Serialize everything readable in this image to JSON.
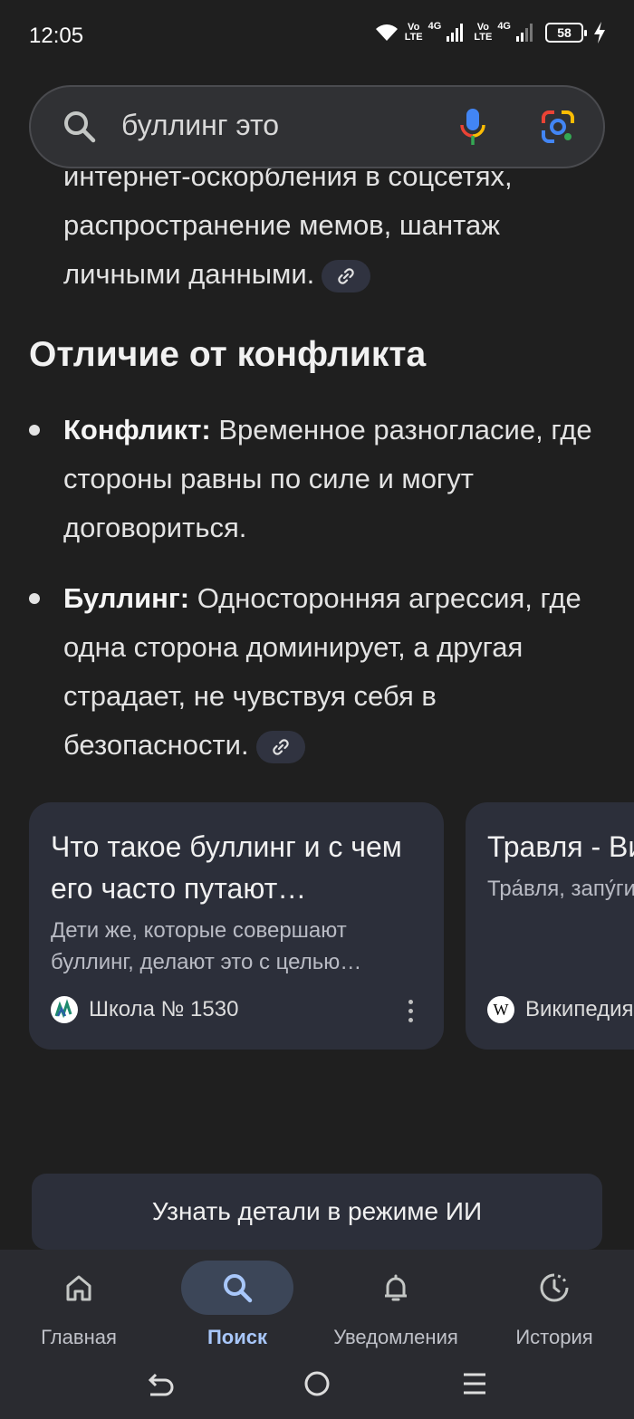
{
  "status_bar": {
    "time": "12:05",
    "sim1_label_top": "Vo",
    "sim1_label_bottom": "LTE",
    "sim1_net": "4G",
    "sim2_label_top": "Vo",
    "sim2_label_bottom": "LTE",
    "sim2_net": "4G",
    "battery": "58"
  },
  "search": {
    "query": "буллинг это"
  },
  "content": {
    "partial_line": "интернет-оскорбления в соцсетях,",
    "para_line1": "распространение мемов, шантаж",
    "para_line2": "личными данными.",
    "section_title": "Отличие от конфликта",
    "bullets": [
      {
        "term": "Конфликт:",
        "text": " Временное разногласие, где стороны равны по силе и могут договориться."
      },
      {
        "term": "Буллинг:",
        "text": " Односторонняя агрессия, где одна сторона доминирует, а другая страдает, не чувствуя себя в безопасности."
      }
    ]
  },
  "cards": [
    {
      "title": "Что такое буллинг и с чем его часто путают…",
      "snippet": "Дети же, которые совершают буллинг, делают это с целью…",
      "source": "Школа № 1530"
    },
    {
      "title": "Травля - Википедия",
      "snippet": "Тра́вля, запу́гивание, задира́ние, б",
      "source": "Википедия"
    }
  ],
  "ai_button": {
    "label": "Узнать детали в режиме ИИ"
  },
  "bottom_nav": {
    "items": [
      {
        "label": "Главная",
        "icon": "home-icon"
      },
      {
        "label": "Поиск",
        "icon": "search-icon"
      },
      {
        "label": "Уведомления",
        "icon": "bell-icon"
      },
      {
        "label": "История",
        "icon": "history-icon"
      }
    ],
    "active_index": 1
  },
  "colors": {
    "background": "#1f1f1f",
    "card": "#2c2f3a",
    "active_nav": "#a8c7fa"
  }
}
